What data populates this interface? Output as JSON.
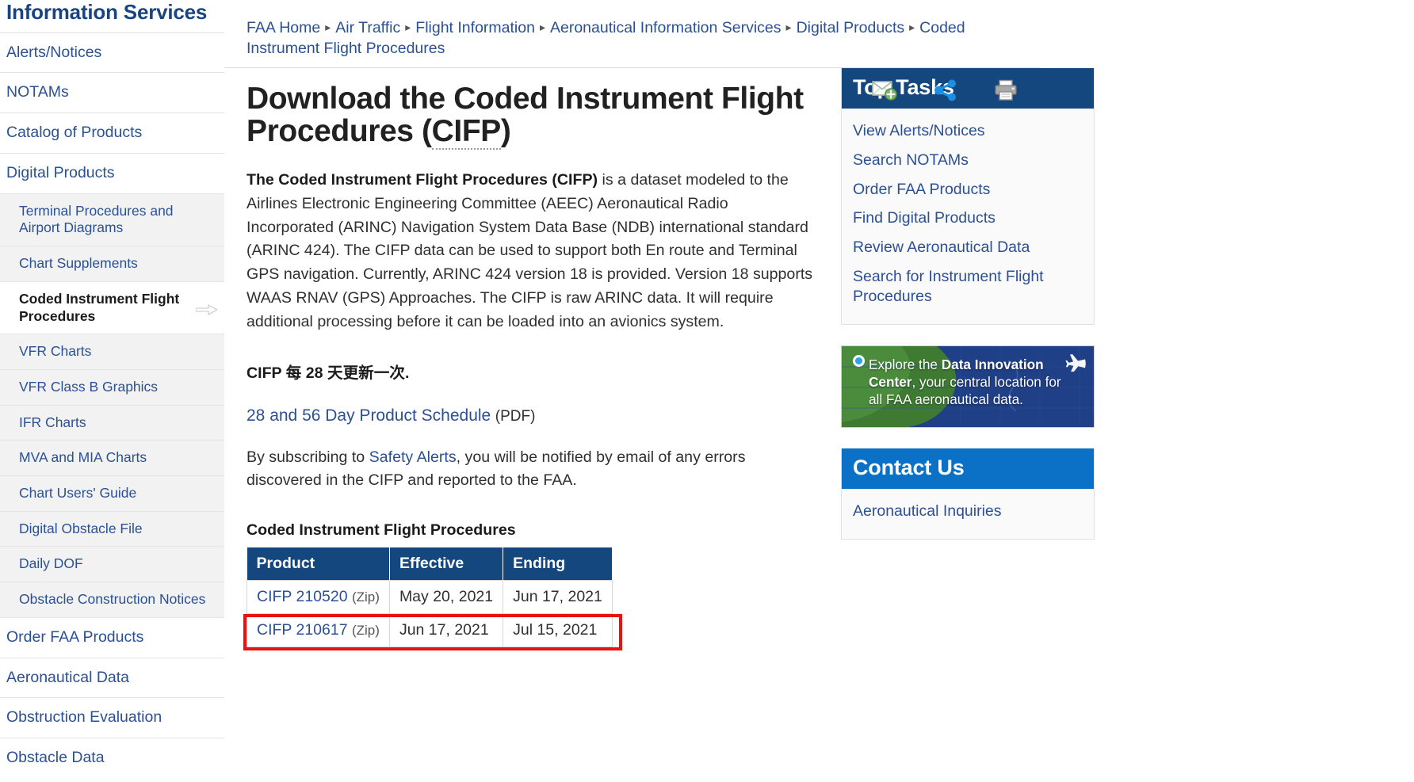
{
  "sidebar": {
    "title": "Information Services",
    "items": [
      {
        "label": "Alerts/Notices",
        "type": "top"
      },
      {
        "label": "NOTAMs",
        "type": "top"
      },
      {
        "label": "Catalog of Products",
        "type": "top"
      },
      {
        "label": "Digital Products",
        "type": "top"
      }
    ],
    "sub_items": [
      {
        "label": "Terminal Procedures and Airport Diagrams",
        "active": false
      },
      {
        "label": "Chart Supplements",
        "active": false
      },
      {
        "label": "Coded Instrument Flight Procedures",
        "active": true
      },
      {
        "label": "VFR Charts",
        "active": false
      },
      {
        "label": "VFR Class B Graphics",
        "active": false
      },
      {
        "label": "IFR Charts",
        "active": false
      },
      {
        "label": "MVA and MIA Charts",
        "active": false
      },
      {
        "label": "Chart Users' Guide",
        "active": false
      },
      {
        "label": "Digital Obstacle File",
        "active": false
      },
      {
        "label": "Daily DOF",
        "active": false
      },
      {
        "label": "Obstacle Construction Notices",
        "active": false
      }
    ],
    "items_bottom": [
      {
        "label": "Order FAA Products"
      },
      {
        "label": "Aeronautical Data"
      },
      {
        "label": "Obstruction Evaluation"
      },
      {
        "label": "Obstacle Data"
      }
    ]
  },
  "breadcrumb": {
    "items": [
      "FAA Home",
      "Air Traffic",
      "Flight Information",
      "Aeronautical Information Services",
      "Digital Products",
      "Coded Instrument Flight Procedures"
    ],
    "separator": "▸"
  },
  "header": {
    "title_part1": "Download the Coded Instrument Procedures (",
    "title": "Download the Coded Instrument Flight Procedures (CIFP)",
    "title_line1": "Download the Coded Instrument Flight",
    "title_line2_pre": "Procedures (",
    "title_abbr": "CIFP",
    "title_line2_post": ")",
    "icons": [
      {
        "name": "email-subscribe-icon",
        "label": "Email"
      },
      {
        "name": "share-icon",
        "label": "Share"
      },
      {
        "name": "print-icon",
        "label": "Print"
      }
    ]
  },
  "main": {
    "intro_bold": "The Coded Instrument Flight Procedures (CIFP)",
    "intro_rest": " is a dataset modeled to the Airlines Electronic Engineering Committee (AEEC) Aeronautical Radio Incorporated (ARINC) Navigation System Data Base (NDB) international standard (ARINC 424). The CIFP data can be used to support both En route and Terminal GPS navigation. Currently, ARINC 424 version 18 is provided. Version 18 supports WAAS RNAV (GPS) Approaches. The CIFP is raw ARINC data. It will require additional processing before it can be loaded into an avionics system.",
    "update_note": "CIFP 每 28 天更新一次.",
    "schedule_link": "28 and 56 Day Product Schedule",
    "schedule_suffix": "(PDF)",
    "subscribe_pre": "By subscribing to ",
    "subscribe_link": "Safety Alerts",
    "subscribe_post": ", you will be notified by email of any errors discovered in the CIFP and reported to the FAA.",
    "table_caption": "Coded Instrument Flight Procedures",
    "table": {
      "columns": [
        "Product",
        "Effective",
        "Ending"
      ],
      "rows": [
        {
          "product": "CIFP 210520",
          "zip": "(Zip)",
          "effective": "May 20, 2021",
          "ending": "Jun 17, 2021",
          "highlighted": false
        },
        {
          "product": "CIFP 210617",
          "zip": "(Zip)",
          "effective": "Jun 17, 2021",
          "ending": "Jul 15, 2021",
          "highlighted": true
        }
      ]
    }
  },
  "right_rail": {
    "top_tasks": {
      "heading": "Top Tasks",
      "links": [
        "View Alerts/Notices",
        "Search NOTAMs",
        "Order FAA Products",
        "Find Digital Products",
        "Review Aeronautical Data",
        "Search for Instrument Flight Procedures"
      ]
    },
    "promo": {
      "pre": "Explore the ",
      "bold": "Data Innovation Center",
      "post": ", your central location for all FAA aeronautical data."
    },
    "contact": {
      "heading": "Contact Us",
      "links": [
        "Aeronautical Inquiries"
      ]
    }
  },
  "colors": {
    "navy": "#14477d",
    "blue": "#0b71c6",
    "link": "#2b5093",
    "highlight": "#e8120f"
  }
}
